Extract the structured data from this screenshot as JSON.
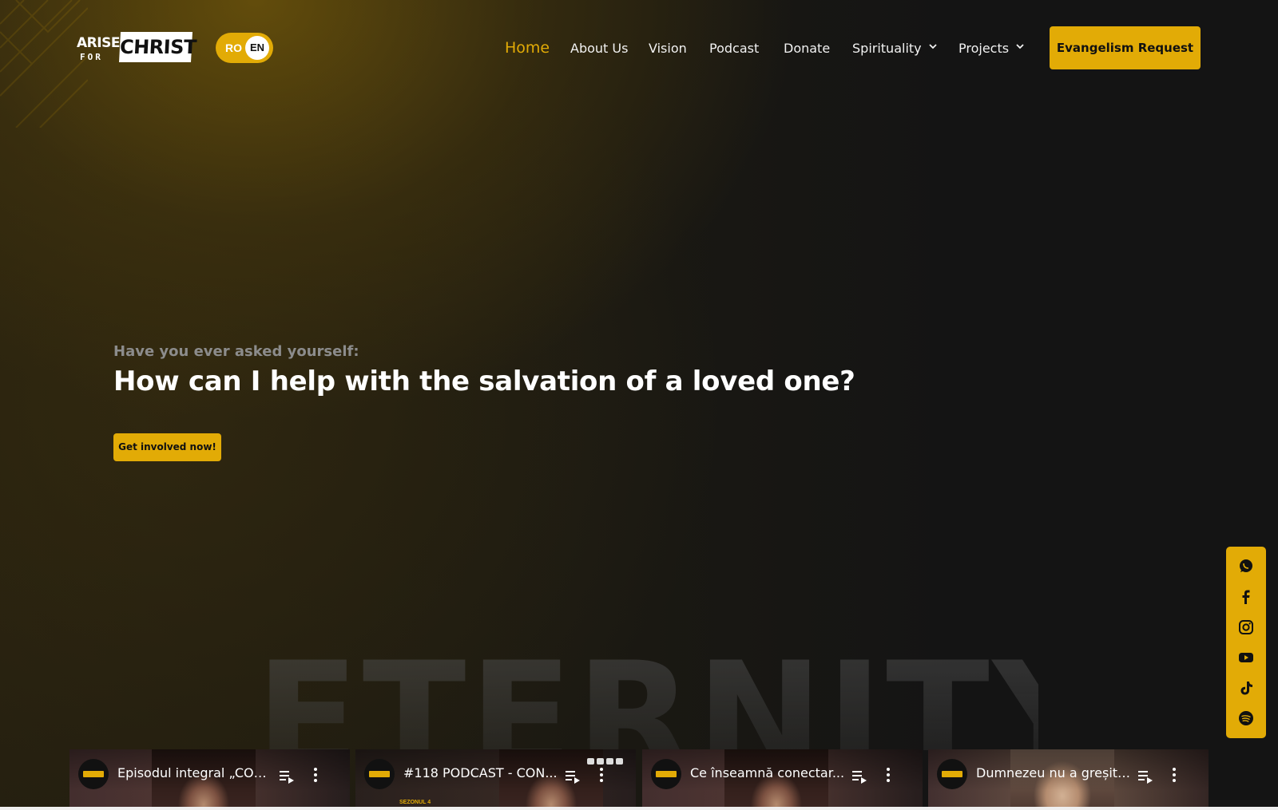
{
  "brand": {
    "logo_line1": "ARISE",
    "logo_line2": "FOR",
    "logo_line3": "CHRIST",
    "accent_color": "#e2ab06"
  },
  "language": {
    "options": [
      "RO",
      "EN"
    ],
    "selected": "EN"
  },
  "nav": {
    "items": [
      {
        "label": "Home",
        "active": true
      },
      {
        "label": "About Us"
      },
      {
        "label": "Vision"
      },
      {
        "label": "Podcast"
      },
      {
        "label": "Donate"
      },
      {
        "label": "Spirituality",
        "dropdown": true
      },
      {
        "label": "Projects",
        "dropdown": true
      }
    ],
    "cta_label": "Evangelism Request"
  },
  "hero": {
    "kicker": "Have you ever asked yourself:",
    "headline": "How can I help with the salvation of a loved one?",
    "button_label": "Get involved now!",
    "background_word": "ETERNITY"
  },
  "social": {
    "icons": [
      "whatsapp-icon",
      "facebook-icon",
      "instagram-icon",
      "youtube-icon",
      "tiktok-icon",
      "spotify-icon"
    ]
  },
  "videos": [
    {
      "title": "Episodul integral „CON..."
    },
    {
      "title": "#118 PODCAST - CON...",
      "badge": "SEZONUL 4"
    },
    {
      "title": "Ce înseamnă conectar..."
    },
    {
      "title": "Dumnezeu nu a greșit ..."
    }
  ]
}
